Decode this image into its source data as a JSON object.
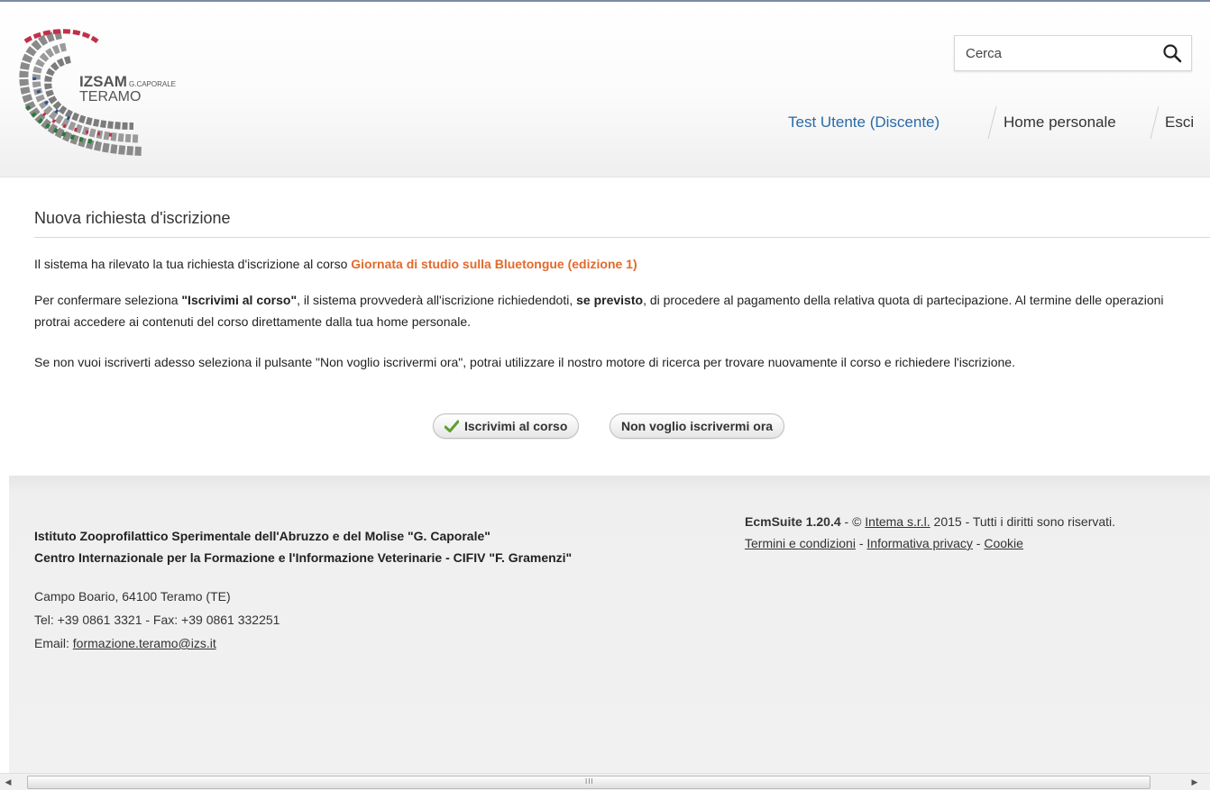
{
  "header": {
    "logo_line1": "IZSAM",
    "logo_line1_small": "G.CAPORALE",
    "logo_line2": "TERAMO",
    "search": {
      "value": "",
      "placeholder": "Cerca"
    },
    "nav": {
      "user": "Test Utente (Discente)",
      "home": "Home personale",
      "exit": "Esci"
    }
  },
  "main": {
    "title": "Nuova richiesta d'iscrizione",
    "p1_prefix": "Il sistema ha rilevato la tua richiesta d'iscrizione al corso ",
    "course_name": "Giornata di studio sulla Bluetongue (edizione 1)",
    "p2_a": "Per confermare seleziona ",
    "p2_bold1": "\"Iscrivimi al corso\"",
    "p2_b": ", il sistema provvederà all'iscrizione richiedendoti, ",
    "p2_bold2": "se previsto",
    "p2_c": ", di procedere al pagamento della relativa quota di partecipazione. Al termine delle operazioni protrai accedere ai contenuti del corso direttamente dalla tua home personale.",
    "p3": "Se non vuoi iscriverti adesso seleziona il pulsante \"Non voglio iscrivermi ora\", potrai utilizzare il nostro motore di ricerca per trovare nuovamente il corso e richiedere l'iscrizione.",
    "btn_enroll": "Iscrivimi al corso",
    "btn_decline": "Non voglio iscrivermi ora"
  },
  "footer": {
    "org1": "Istituto Zooprofilattico Sperimentale dell'Abruzzo e del Molise \"G. Caporale\"",
    "org2": "Centro Internazionale per la Formazione e l'Informazione Veterinarie - CIFIV \"F. Gramenzi\"",
    "address": "Campo Boario, 64100 Teramo (TE)",
    "tel": "Tel: +39 0861 3321 - Fax: +39 0861 332251",
    "email_label": "Email: ",
    "email": "formazione.teramo@izs.it",
    "suite": "EcmSuite 1.20.4",
    "copyright_a": " - © ",
    "company": "Intema s.r.l.",
    "copyright_b": " 2015 - Tutti i diritti sono riservati.",
    "terms": "Termini e condizioni",
    "privacy": "Informativa privacy",
    "cookie": "Cookie",
    "sep": " - "
  },
  "scrollbar": {
    "left_arrow": "◀",
    "right_arrow": "▶",
    "grip": "III"
  },
  "colors": {
    "accent_link": "#e26a2c",
    "user_link": "#2a6aa8"
  }
}
